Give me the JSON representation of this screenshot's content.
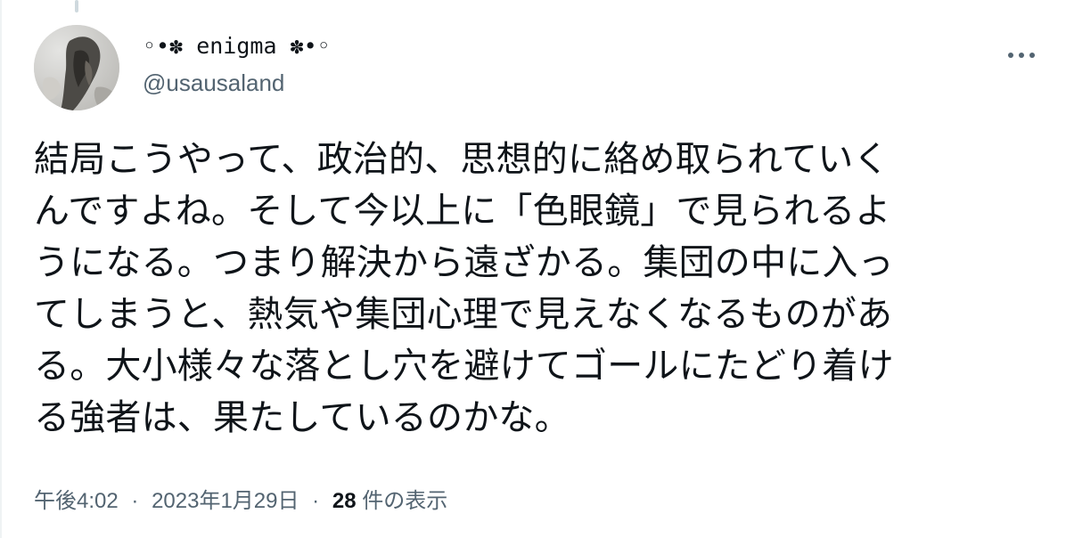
{
  "tweet": {
    "author": {
      "display_name": "◦•✽ enigma ✽•◦",
      "handle": "@usausaland",
      "avatar_icon": "profile-photo-icon"
    },
    "more_icon": "more-horizontal-icon",
    "text_lines": [
      "結局こうやって、政治的、思想的に絡め取られていく",
      "んですよね。そして今以上に「色眼鏡」で見られるよ",
      "うになる。つまり解決から遠ざかる。集団の中に入っ",
      "てしまうと、熱気や集団心理で見えなくなるものがあ",
      "る。大小様々な落とし穴を避けてゴールにたどり着け",
      "る強者は、果たしているのかな。"
    ],
    "meta": {
      "time": "午後4:02",
      "separator_1": "·",
      "date": "2023年1月29日",
      "separator_2": "·",
      "views_count": "28",
      "views_label": " 件の表示"
    }
  },
  "colors": {
    "text_primary": "#0f1419",
    "text_secondary": "#536471",
    "background": "#ffffff",
    "thread_line": "#cfd9de"
  }
}
